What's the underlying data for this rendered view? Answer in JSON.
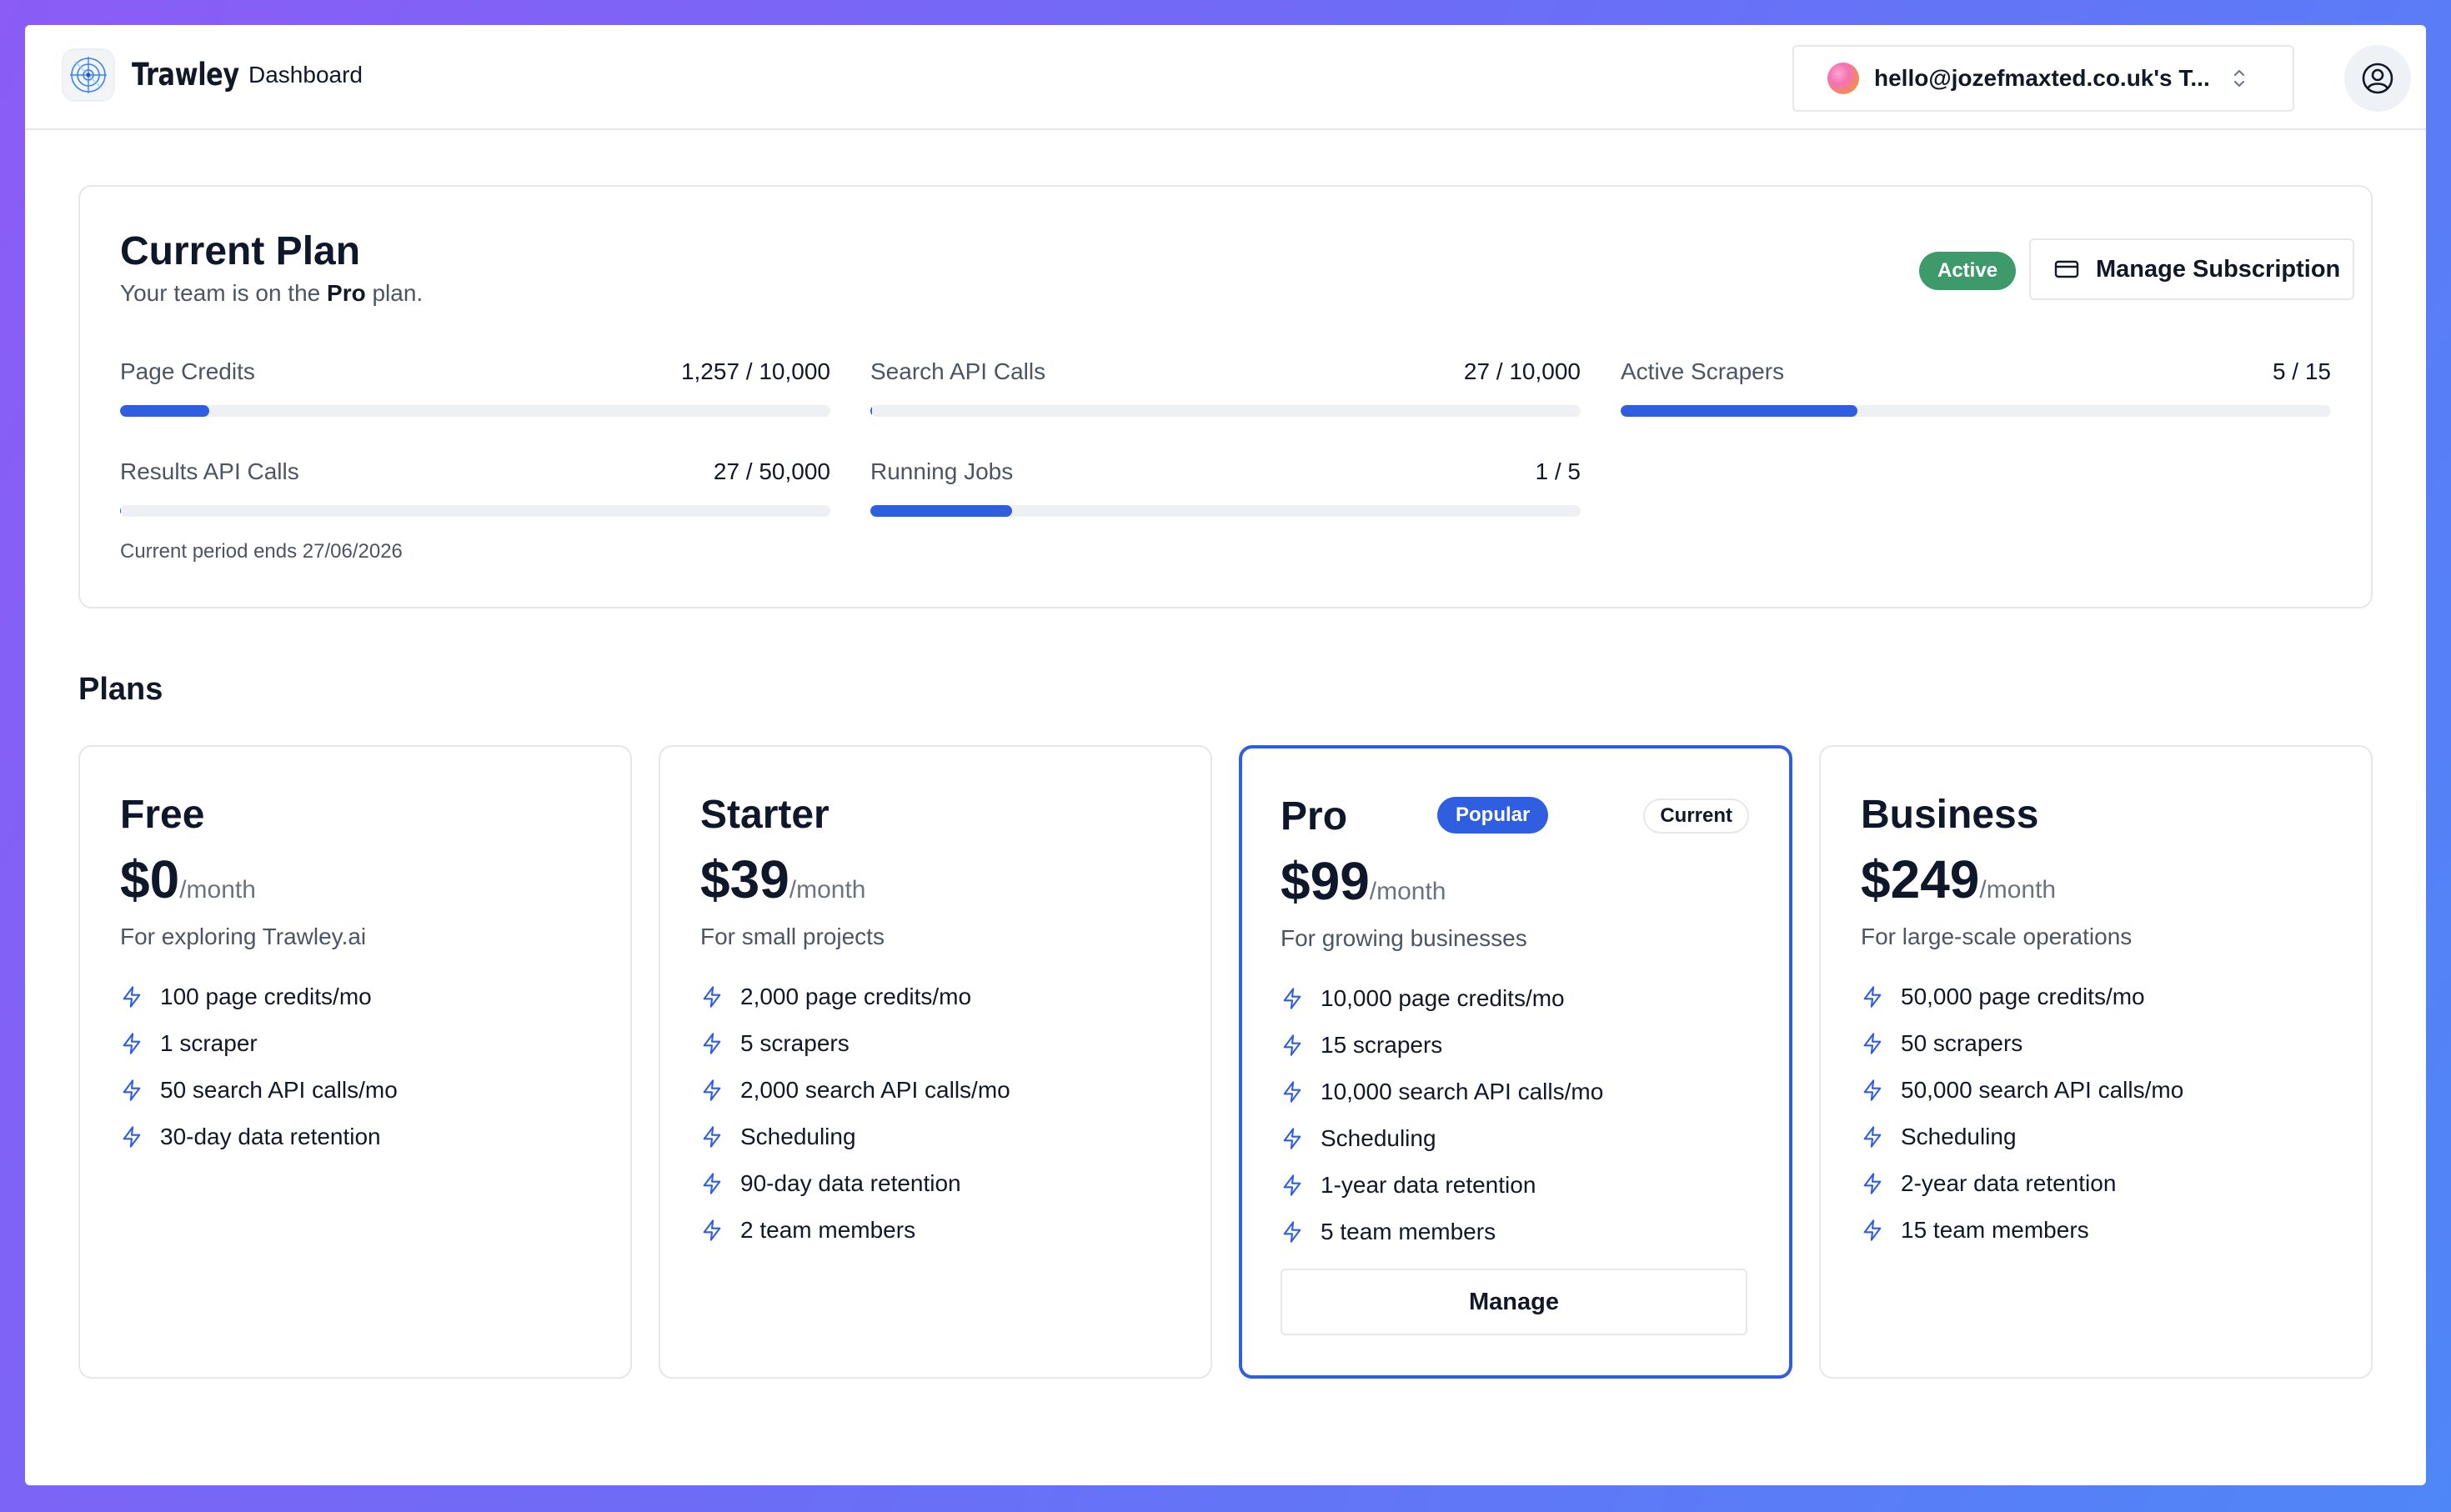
{
  "header": {
    "app_name": "Trawley",
    "nav_item": "Dashboard",
    "team_switcher_label": "hello@jozefmaxted.co.uk's T...",
    "brand_color": "#2f5fe0"
  },
  "current_plan": {
    "title": "Current Plan",
    "subtitle_prefix": "Your team is on the ",
    "plan_name": "Pro",
    "subtitle_suffix": " plan.",
    "status_badge": "Active",
    "status_color": "#3f9a6b",
    "manage_button": "Manage Subscription",
    "metrics": [
      {
        "label": "Page Credits",
        "value": "1,257 / 10,000",
        "fraction": 0.1257
      },
      {
        "label": "Search API Calls",
        "value": "27 / 10,000",
        "fraction": 0.0027
      },
      {
        "label": "Active Scrapers",
        "value": "5 / 15",
        "fraction": 0.3333
      },
      {
        "label": "Results API Calls",
        "value": "27 / 50,000",
        "fraction": 0.00054
      },
      {
        "label": "Running Jobs",
        "value": "1 / 5",
        "fraction": 0.2
      }
    ],
    "period_text": "Current period ends 27/06/2026"
  },
  "plans_heading": "Plans",
  "plans": [
    {
      "name": "Free",
      "price": "$0",
      "per": "/month",
      "description": "For exploring Trawley.ai",
      "features": [
        "100 page credits/mo",
        "1 scraper",
        "50 search API calls/mo",
        "30-day data retention"
      ]
    },
    {
      "name": "Starter",
      "price": "$39",
      "per": "/month",
      "description": "For small projects",
      "features": [
        "2,000 page credits/mo",
        "5 scrapers",
        "2,000 search API calls/mo",
        "Scheduling",
        "90-day data retention",
        "2 team members"
      ]
    },
    {
      "name": "Pro",
      "price": "$99",
      "per": "/month",
      "description": "For growing businesses",
      "popular_badge": "Popular",
      "current_badge": "Current",
      "button": "Manage",
      "features": [
        "10,000 page credits/mo",
        "15 scrapers",
        "10,000 search API calls/mo",
        "Scheduling",
        "1-year data retention",
        "5 team members"
      ]
    },
    {
      "name": "Business",
      "price": "$249",
      "per": "/month",
      "description": "For large-scale operations",
      "features": [
        "50,000 page credits/mo",
        "50 scrapers",
        "50,000 search API calls/mo",
        "Scheduling",
        "2-year data retention",
        "15 team members"
      ]
    }
  ]
}
